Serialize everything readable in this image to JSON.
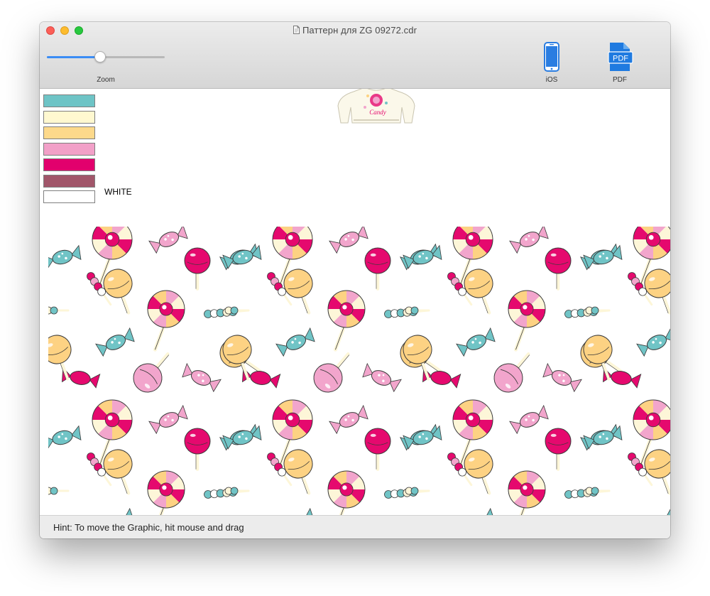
{
  "window": {
    "title": "Паттерн для ZG 09272.cdr",
    "controls": [
      "close-button",
      "minimize-button",
      "zoom-button"
    ]
  },
  "toolbar": {
    "zoom": {
      "label": "Zoom",
      "value": 0.45
    },
    "ios_label": "iOS",
    "pdf_label": "PDF",
    "pdf_icon_text": "PDF"
  },
  "palette": {
    "swatches": [
      "#6ec4c6",
      "#fff8d0",
      "#fdd98b",
      "#f2a0c8",
      "#e2006d",
      "#a1566a",
      "#ffffff"
    ],
    "white_label": "WHITE"
  },
  "preview": {
    "sweater_text": "Candy"
  },
  "pattern": {
    "colors": {
      "pink": "#e5096e",
      "light_pink": "#f2a5cc",
      "yellow": "#fdd283",
      "cream": "#fdf6d8",
      "teal": "#70c4c6",
      "outline": "#3a3a3a"
    }
  },
  "status": {
    "hint": "Hint: To move the Graphic, hit mouse and drag"
  }
}
